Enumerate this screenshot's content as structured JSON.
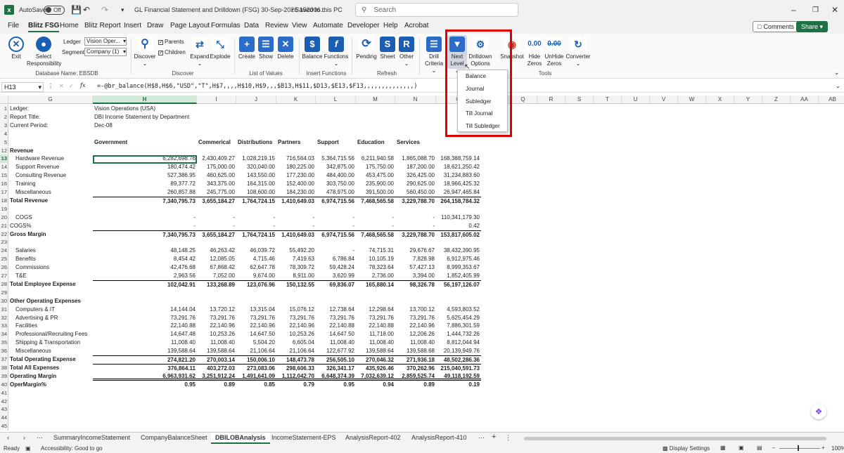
{
  "titlebar": {
    "autosave_label": "AutoSave",
    "autosave_state": "Off",
    "doc_title": "GL Financial Statement and Drilldown (FSG) 30-Sep-2026 152006...",
    "saved_status": "• Saved to this PC",
    "search_placeholder": "Search"
  },
  "menu": {
    "tabs": [
      "File",
      "Blitz FSG",
      "Home",
      "Blitz Report",
      "Insert",
      "Draw",
      "Page Layout",
      "Formulas",
      "Data",
      "Review",
      "View",
      "Automate",
      "Developer",
      "Help",
      "Acrobat"
    ],
    "comments_label": "Comments",
    "share_label": "Share"
  },
  "ribbon": {
    "exit": "Exit",
    "select": "Select",
    "responsibility": "Responsibility",
    "ledger_label": "Ledger",
    "ledger_value": "Vision Oper...",
    "segment_label": "Segment",
    "segment_value": "Company (1)",
    "db_group": "Database Name: EBSDB",
    "discover": "Discover",
    "parents": "Parents",
    "children": "Children",
    "expand": "Expand",
    "explode": "Explode",
    "discover_group": "Discover",
    "create": "Create",
    "show": "Show",
    "delete": "Delete",
    "lov_group": "List of Values",
    "balance": "Balance",
    "functions": "Functions",
    "insert_group": "Insert Functions",
    "pending": "Pending",
    "sheet": "Sheet",
    "other": "Other",
    "refresh_group": "Refresh",
    "drill": "Drill",
    "criteria": "Criteria",
    "next": "Next",
    "level": "Level",
    "drilldown": "Drilldown",
    "options": "Options",
    "snapshot": "Snapshot",
    "hide": "Hide",
    "zeros": "Zeros",
    "unhide": "UnHide",
    "zeros2": "Zeros",
    "converter": "Converter",
    "tools_group": "Tools"
  },
  "dropdown": {
    "items": [
      "Balance",
      "Journal",
      "Subledger",
      "Till Journal",
      "Till Subledger"
    ]
  },
  "formula_bar": {
    "cell_ref": "H13",
    "fx": "fx",
    "formula": "=-@br_balance(H$8,H$6,\"USD\",\"T\",H$7,,,,H$10,H$9,,,$B13,H$11,$D13,$E13,$F13,,,,,,,,,,,,,,)"
  },
  "columns": {
    "headers": [
      "G",
      "H",
      "I",
      "J",
      "K",
      "L",
      "M",
      "N",
      "O",
      "P",
      "Q",
      "R",
      "S",
      "T",
      "U",
      "V",
      "W",
      "X",
      "Y",
      "Z",
      "AA",
      "AB"
    ]
  },
  "header_info": {
    "ledger_label": "Ledger:",
    "ledger_value": "Vision Operations (USA)",
    "title_label": "Report Title:",
    "title_value": "DBI Income Statement by Department",
    "period_label": "Current Period:",
    "period_value": "Dec-08"
  },
  "departments": [
    "Government",
    "Commerical",
    "Distributions",
    "Partners",
    "Support",
    "Education",
    "Services"
  ],
  "rows": [
    {
      "r": "12",
      "label": "Revenue",
      "bold": true,
      "vals": []
    },
    {
      "r": "13",
      "label": "Hardware Revenue",
      "indent": true,
      "vals": [
        "6,282,698.76",
        "2,430,409.27",
        "1,028,219.15",
        "716,564.03",
        "5,364,715.56",
        "6,211,940.58",
        "1,865,088.70",
        "168,388,759.14"
      ]
    },
    {
      "r": "14",
      "label": "Support Revenue",
      "indent": true,
      "vals": [
        "180,474.42",
        "175,000.00",
        "320,040.00",
        "180,225.00",
        "342,875.00",
        "175,750.00",
        "187,200.00",
        "18,621,250.42"
      ]
    },
    {
      "r": "15",
      "label": "Consulting Revenue",
      "indent": true,
      "vals": [
        "527,386.95",
        "460,625.00",
        "143,550.00",
        "177,230.00",
        "484,400.00",
        "453,475.00",
        "326,425.00",
        "31,234,883.60"
      ]
    },
    {
      "r": "16",
      "label": "Training",
      "indent": true,
      "vals": [
        "89,377.72",
        "343,375.00",
        "164,315.00",
        "152,400.00",
        "303,750.00",
        "235,900.00",
        "290,625.00",
        "18,966,425.32"
      ]
    },
    {
      "r": "17",
      "label": "Miscellaneous",
      "indent": true,
      "vals": [
        "260,857.88",
        "245,775.00",
        "108,600.00",
        "184,230.00",
        "478,975.00",
        "391,500.00",
        "560,450.00",
        "26,947,465.84"
      ]
    },
    {
      "r": "18",
      "label": "Total Revenue",
      "bold": true,
      "topline": true,
      "vals": [
        "7,340,795.73",
        "3,655,184.27",
        "1,764,724.15",
        "1,410,649.03",
        "6,974,715.56",
        "7,468,565.58",
        "3,229,788.70",
        "264,158,784.32"
      ]
    },
    {
      "r": "19",
      "label": "",
      "vals": []
    },
    {
      "r": "20",
      "label": "COGS",
      "indent": true,
      "vals": [
        "-",
        "-",
        "-",
        "-",
        "-",
        "-",
        "-",
        "110,341,179.30"
      ]
    },
    {
      "r": "21",
      "label": "COGS%",
      "vals": [
        "-",
        "-",
        "-",
        "-",
        "-",
        "-",
        "-",
        "0.42"
      ]
    },
    {
      "r": "22",
      "label": "Gross Margin",
      "bold": true,
      "topline": true,
      "vals": [
        "7,340,795.73",
        "3,655,184.27",
        "1,764,724.15",
        "1,410,649.03",
        "6,974,715.56",
        "7,468,565.58",
        "3,229,788.70",
        "153,817,605.02"
      ]
    },
    {
      "r": "23",
      "label": "",
      "vals": []
    },
    {
      "r": "24",
      "label": "Salaries",
      "indent": true,
      "vals": [
        "48,148.25",
        "46,263.42",
        "46,039.72",
        "55,492.20",
        "-",
        "74,715.31",
        "29,676.67",
        "38,432,390.95"
      ]
    },
    {
      "r": "25",
      "label": "Benefits",
      "indent": true,
      "vals": [
        "8,454.42",
        "12,085.05",
        "4,715.46",
        "7,419.63",
        "6,786.84",
        "10,105.19",
        "7,828.98",
        "6,912,975.46"
      ]
    },
    {
      "r": "26",
      "label": "Commissions",
      "indent": true,
      "vals": [
        "42,476.68",
        "67,868.42",
        "62,647.78",
        "78,309.72",
        "59,428.24",
        "78,323.64",
        "57,427.13",
        "8,999,353.67"
      ]
    },
    {
      "r": "27",
      "label": "T&E",
      "indent": true,
      "vals": [
        "2,963.56",
        "7,052.00",
        "9,674.00",
        "8,911.00",
        "3,620.99",
        "2,736.00",
        "3,394.00",
        "1,852,405.99"
      ]
    },
    {
      "r": "28",
      "label": "Total Employee Expense",
      "bold": true,
      "topline": true,
      "vals": [
        "102,042.91",
        "133,268.89",
        "123,076.96",
        "150,132.55",
        "69,836.07",
        "165,880.14",
        "98,326.78",
        "56,197,126.07"
      ]
    },
    {
      "r": "29",
      "label": "",
      "vals": []
    },
    {
      "r": "30",
      "label": "Other Operating Expenses",
      "bold": true,
      "vals": []
    },
    {
      "r": "31",
      "label": "Computers & IT",
      "indent": true,
      "vals": [
        "14,144.04",
        "13,720.12",
        "13,315.04",
        "15,076.12",
        "12,738.64",
        "12,298.64",
        "13,700.12",
        "4,593,803.52"
      ]
    },
    {
      "r": "32",
      "label": "Advertising & PR",
      "indent": true,
      "vals": [
        "73,291.76",
        "73,291.76",
        "73,291.76",
        "73,291.76",
        "73,291.76",
        "73,291.76",
        "73,291.76",
        "5,625,454.29"
      ]
    },
    {
      "r": "33",
      "label": "Facilities",
      "indent": true,
      "vals": [
        "22,140.88",
        "22,140.96",
        "22,140.96",
        "22,140.96",
        "22,140.88",
        "22,140.88",
        "22,140.96",
        "7,886,301.59"
      ]
    },
    {
      "r": "34",
      "label": "Professional/Recruiting Fees",
      "indent": true,
      "vals": [
        "14,647.48",
        "10,253.26",
        "14,647.50",
        "10,253.26",
        "14,647.50",
        "11,718.00",
        "12,206.26",
        "1,444,732.26"
      ]
    },
    {
      "r": "35",
      "label": "Shipping & Transportation",
      "indent": true,
      "vals": [
        "11,008.40",
        "11,008.40",
        "5,504.20",
        "6,605.04",
        "11,008.40",
        "11,008.40",
        "11,008.40",
        "8,812,044.94"
      ]
    },
    {
      "r": "36",
      "label": "Miscellaneous",
      "indent": true,
      "vals": [
        "139,588.64",
        "139,588.64",
        "21,106.64",
        "21,106.64",
        "122,677.92",
        "139,588.64",
        "139,588.68",
        "20,139,949.76"
      ]
    },
    {
      "r": "37",
      "label": "Total Operating Expense",
      "bold": true,
      "topline": true,
      "vals": [
        "274,821.20",
        "270,003.14",
        "150,006.10",
        "148,473.78",
        "256,505.10",
        "270,046.32",
        "271,936.18",
        "48,502,286.36"
      ]
    },
    {
      "r": "38",
      "label": "Total All Expenses",
      "bold": true,
      "topline": true,
      "vals": [
        "376,864.11",
        "403,272.03",
        "273,083.06",
        "298,606.33",
        "326,341.17",
        "435,926.46",
        "370,262.96",
        "215,040,591.73"
      ]
    },
    {
      "r": "39",
      "label": "Operating Margin",
      "bold": true,
      "dbl": true,
      "vals": [
        "6,963,931.62",
        "3,251,912.24",
        "1,491,641.09",
        "1,112,042.70",
        "6,648,374.39",
        "7,032,639.12",
        "2,859,525.74",
        "49,118,192.59"
      ]
    },
    {
      "r": "40",
      "label": "OperMargin%",
      "bold": true,
      "vals": [
        "0.95",
        "0.89",
        "0.85",
        "0.79",
        "0.95",
        "0.94",
        "0.89",
        "0.19"
      ]
    }
  ],
  "empty_rows": [
    "41",
    "42",
    "43",
    "44",
    "45"
  ],
  "sheet_tabs": [
    "SummaryIncomeStatement",
    "CompanyBalanceSheet",
    "DBILOBAnalysis",
    "IncomeStatement-EPS",
    "AnalysisReport-402",
    "AnalysisReport-410"
  ],
  "active_sheet": "DBILOBAnalysis",
  "status": {
    "ready": "Ready",
    "accessibility": "Accessibility: Good to go",
    "display_settings": "Display Settings",
    "zoom": "100%"
  },
  "colors": {
    "accent": "#1e7145",
    "highlight": "#e00000"
  }
}
